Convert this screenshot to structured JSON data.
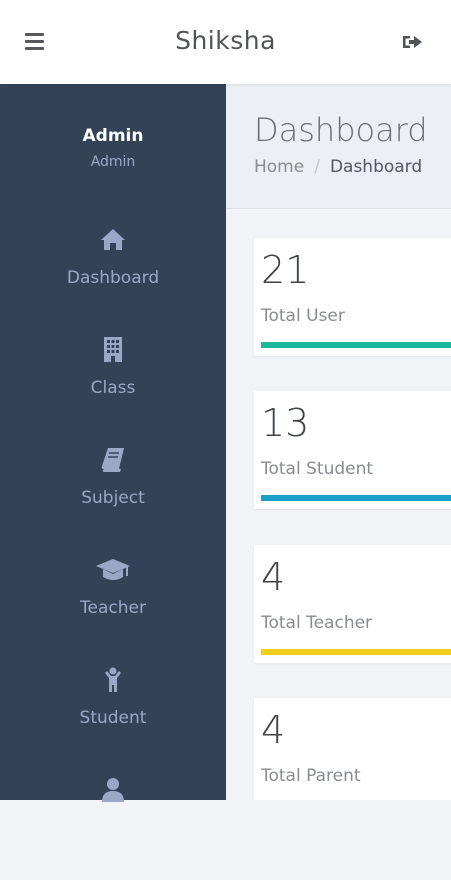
{
  "header": {
    "title": "Shiksha",
    "menu_icon": "hamburger-menu-icon",
    "logout_icon": "sign-out-icon"
  },
  "sidebar": {
    "user": {
      "name": "Admin",
      "role": "Admin"
    },
    "items": [
      {
        "label": "Dashboard",
        "icon": "home-icon"
      },
      {
        "label": "Class",
        "icon": "building-icon"
      },
      {
        "label": "Subject",
        "icon": "book-icon"
      },
      {
        "label": "Teacher",
        "icon": "graduation-cap-icon"
      },
      {
        "label": "Student",
        "icon": "child-icon"
      },
      {
        "label": "",
        "icon": "user-icon"
      }
    ]
  },
  "page": {
    "title": "Dashboard",
    "breadcrumb": {
      "home": "Home",
      "separator": "/",
      "current": "Dashboard"
    }
  },
  "stats": [
    {
      "value": "21",
      "label": "Total User",
      "color": "#1bb99a"
    },
    {
      "value": "13",
      "label": "Total Student",
      "color": "#1a9fc8"
    },
    {
      "value": "4",
      "label": "Total Teacher",
      "color": "#f0cf1f"
    },
    {
      "value": "4",
      "label": "Total Parent",
      "color": "#f05050"
    }
  ],
  "colors": {
    "sidebar_bg": "#344258",
    "sidebar_text": "#9aa8c7",
    "page_bg": "#f1f3f7"
  }
}
